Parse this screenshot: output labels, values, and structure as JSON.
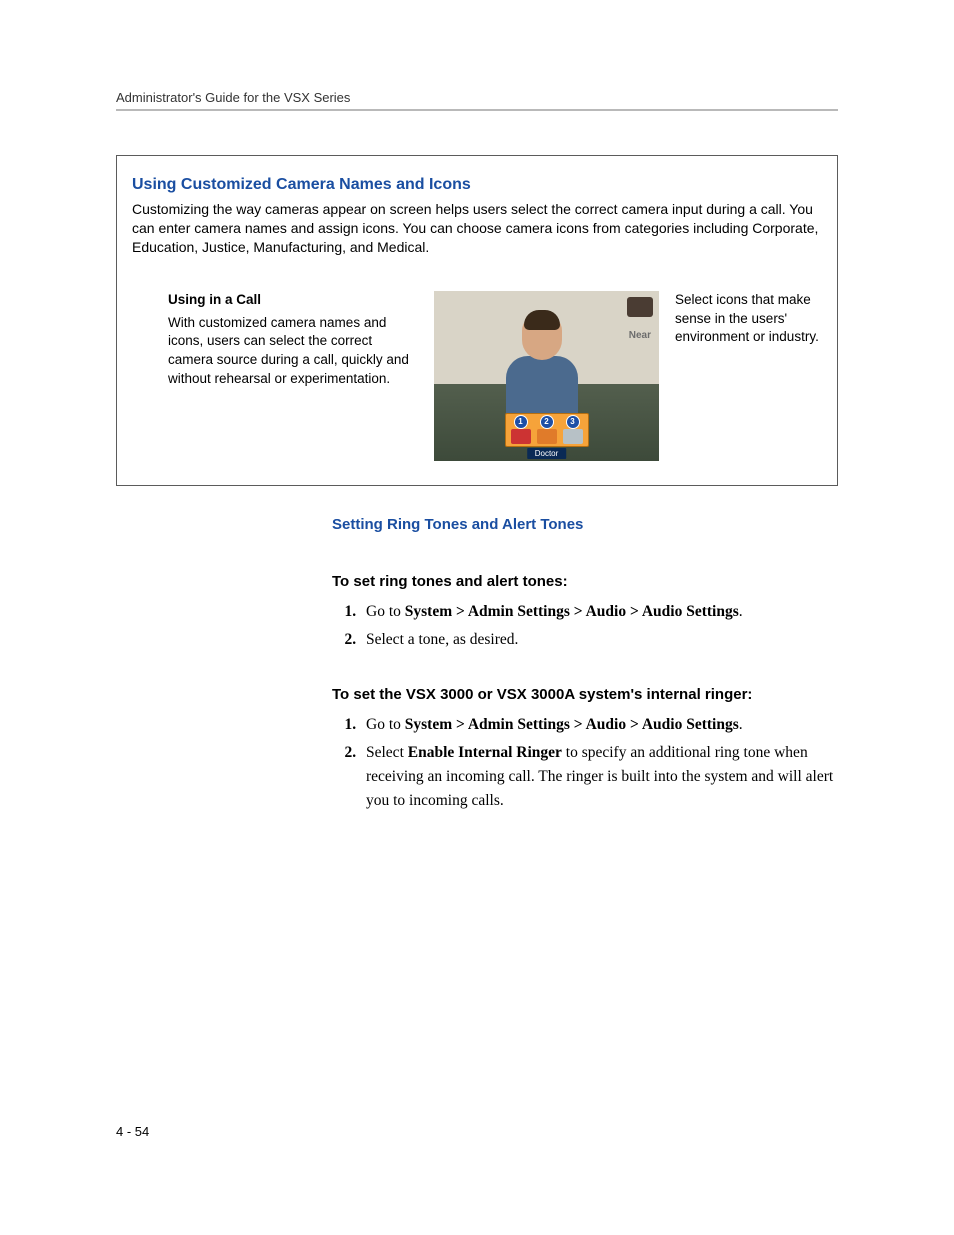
{
  "header": {
    "running": "Administrator's Guide for the VSX Series"
  },
  "feature": {
    "title": "Using Customized Camera Names and Icons",
    "intro": "Customizing the way cameras appear on screen helps users select the correct camera input during a call. You can enter camera names and assign icons. You can choose camera icons from categories including Corporate, Education, Justice, Manufacturing, and Medical.",
    "left_heading": "Using in a Call",
    "left_body": "With customized camera names and icons, users can select the correct camera source during a call, quickly and without rehearsal or experimentation.",
    "right_body": "Select icons that make sense in the users' environment or industry.",
    "screenshot": {
      "near_label": "Near",
      "badges": [
        "1",
        "2",
        "3"
      ],
      "doctor_label": "Doctor"
    }
  },
  "ringtones": {
    "section_title": "Setting Ring Tones and Alert Tones",
    "task1_heading": "To set ring tones and alert tones:",
    "task1_step1_pre": "Go to ",
    "task1_step1_bold": "System > Admin Settings > Audio > Audio Settings",
    "task1_step1_post": ".",
    "task1_step2": "Select a tone, as desired.",
    "task2_heading": "To set the VSX 3000 or VSX 3000A system's internal ringer:",
    "task2_step1_pre": "Go to ",
    "task2_step1_bold": "System > Admin Settings > Audio > Audio Settings",
    "task2_step1_post": ".",
    "task2_step2_pre": "Select ",
    "task2_step2_bold": "Enable Internal Ringer",
    "task2_step2_post": " to specify an additional ring tone when receiving an incoming call. The ringer is built into the system and will alert you to incoming calls."
  },
  "footer": {
    "page_number": "4 - 54"
  }
}
